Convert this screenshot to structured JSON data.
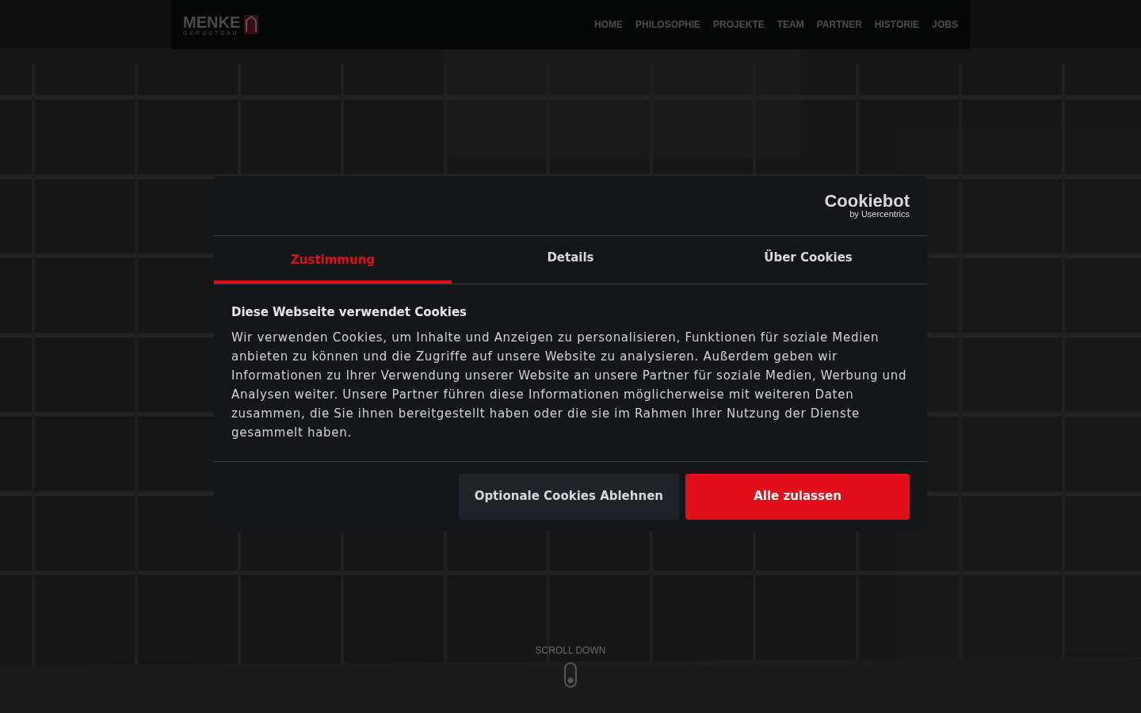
{
  "header": {
    "logo": {
      "name": "MENKE",
      "subtitle": "GERUSTBAU"
    },
    "nav": [
      {
        "label": "HOME"
      },
      {
        "label": "PHILOSOPHIE"
      },
      {
        "label": "PROJEKTE"
      },
      {
        "label": "TEAM"
      },
      {
        "label": "PARTNER"
      },
      {
        "label": "HISTORIE"
      },
      {
        "label": "JOBS"
      }
    ]
  },
  "hero": {
    "kind": "picture",
    "scroll_hint": "SCROLL DOWN"
  },
  "cookie_dialog": {
    "brand": {
      "name": "Cookiebot",
      "byline": "by Usercentrics"
    },
    "tabs": [
      {
        "label": "Zustimmung",
        "selected": true
      },
      {
        "label": "Details",
        "selected": false
      },
      {
        "label": "Über Cookies",
        "selected": false
      }
    ],
    "heading": "Diese Webseite verwendet Cookies",
    "body": "Wir verwenden Cookies, um Inhalte und Anzeigen zu personalisieren, Funktionen für soziale Medien anbieten zu können und die Zugriffe auf unsere Website zu analysieren. Außerdem geben wir Informationen zu Ihrer Verwendung unserer Website an unsere Partner für soziale Medien, Werbung und Analysen weiter. Unsere Partner führen diese Informationen möglicherweise mit weiteren Daten zusammen, die Sie ihnen bereitgestellt haben oder die sie im Rahmen Ihrer Nutzung der Dienste gesammelt haben.",
    "buttons": [
      {
        "label": "Optionale Cookies Ablehnen",
        "kind": "secondary"
      },
      {
        "label": "Alle zulassen",
        "kind": "primary"
      }
    ]
  }
}
